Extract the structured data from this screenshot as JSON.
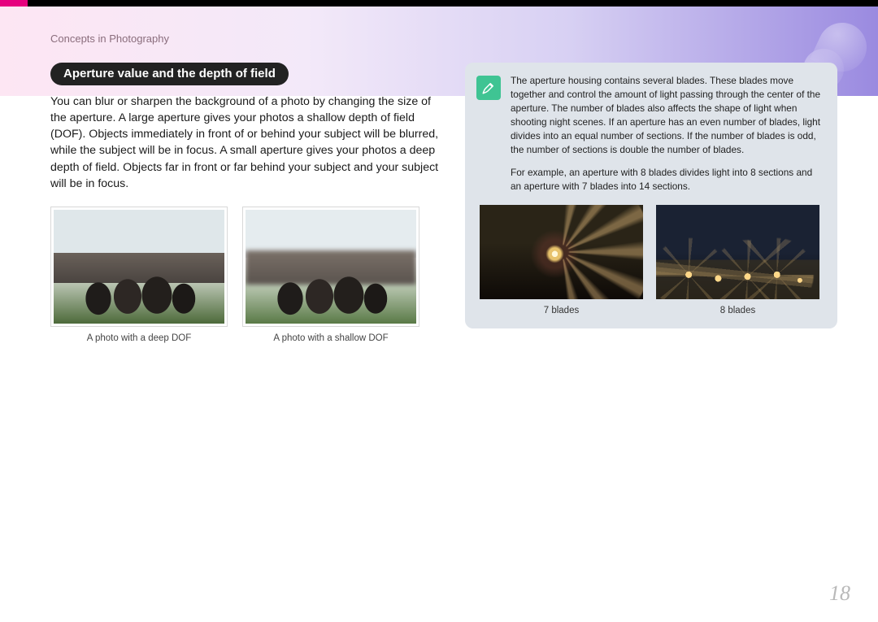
{
  "breadcrumb": "Concepts in Photography",
  "section_heading": "Aperture value and the depth of field",
  "body_paragraph": "You can blur or sharpen the background of a photo by changing the size of the aperture. A large aperture gives your photos a shallow depth of field (DOF). Objects immediately in front of or behind your subject will be blurred, while the subject will be in focus. A small aperture gives your photos a deep depth of field. Objects far in front or far behind your subject and your subject will be in focus.",
  "dof_photos": {
    "deep_caption": "A photo with a deep DOF",
    "shallow_caption": "A photo with a shallow DOF"
  },
  "sidebar": {
    "icon": "pen-icon",
    "paragraph_1": "The aperture housing contains several blades. These blades move together and control the amount of light passing through the center of the aperture. The number of blades also affects the shape of light when shooting night scenes. If an aperture has an even number of blades, light divides into an equal number of sections. If the number of blades is odd, the number of sections is double the number of blades.",
    "paragraph_2": "For example, an aperture with 8 blades divides light into 8 sections and an aperture with 7 blades into 14 sections.",
    "photos": {
      "seven_caption": "7 blades",
      "eight_caption": "8 blades"
    }
  },
  "page_number": "18"
}
